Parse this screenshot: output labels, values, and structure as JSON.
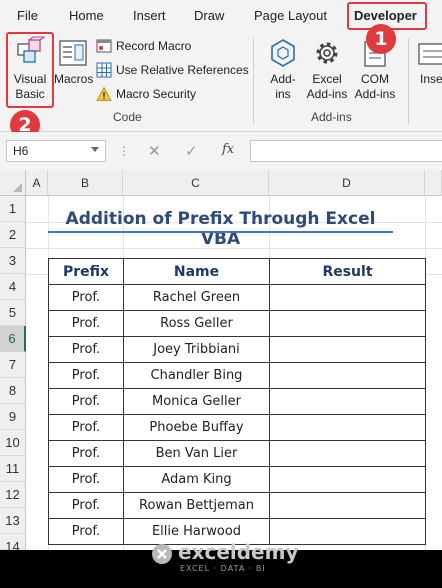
{
  "menu": {
    "tabs": [
      "File",
      "Home",
      "Insert",
      "Draw",
      "Page Layout",
      "Developer",
      "Insert"
    ]
  },
  "ribbon": {
    "code_group": {
      "visual_basic": [
        "Visual",
        "Basic"
      ],
      "macros": "Macros",
      "record_macro": "Record Macro",
      "relative_refs": "Use Relative References",
      "macro_security": "Macro Security",
      "label": "Code"
    },
    "addins_group": {
      "addins": [
        "Add-",
        "ins"
      ],
      "excel_addins": [
        "Excel",
        "Add-ins"
      ],
      "com_addins": [
        "COM",
        "Add-ins"
      ],
      "label": "Add-ins"
    },
    "insert_partial": "Inse"
  },
  "callouts": {
    "one": "1",
    "two": "2"
  },
  "formula_bar": {
    "name_box": "H6",
    "fx": "fx",
    "value": ""
  },
  "sheet": {
    "columns": [
      "A",
      "B",
      "C",
      "D"
    ],
    "rows": [
      "1",
      "2",
      "3",
      "4",
      "5",
      "6",
      "7",
      "8",
      "9",
      "10",
      "11",
      "12",
      "13",
      "14"
    ],
    "selected_row": "6",
    "title": "Addition of  Prefix Through Excel VBA",
    "table": {
      "headers": [
        "Prefix",
        "Name",
        "Result"
      ],
      "rows": [
        [
          "Prof.",
          "Rachel Green",
          ""
        ],
        [
          "Prof.",
          "Ross Geller",
          ""
        ],
        [
          "Prof.",
          "Joey Tribbiani",
          ""
        ],
        [
          "Prof.",
          "Chandler Bing",
          ""
        ],
        [
          "Prof.",
          "Monica Geller",
          ""
        ],
        [
          "Prof.",
          "Phoebe Buffay",
          ""
        ],
        [
          "Prof.",
          "Ben Van Lier",
          ""
        ],
        [
          "Prof.",
          "Adam King",
          ""
        ],
        [
          "Prof.",
          "Rowan Bettjeman",
          ""
        ],
        [
          "Prof.",
          "Ellie Harwood",
          ""
        ]
      ]
    }
  },
  "watermark": {
    "name": "exceldemy",
    "tagline": "EXCEL · DATA · BI"
  },
  "colors": {
    "accent_red": "#e0393e",
    "excel_green": "#217346",
    "title_blue": "#2f4a7a"
  }
}
